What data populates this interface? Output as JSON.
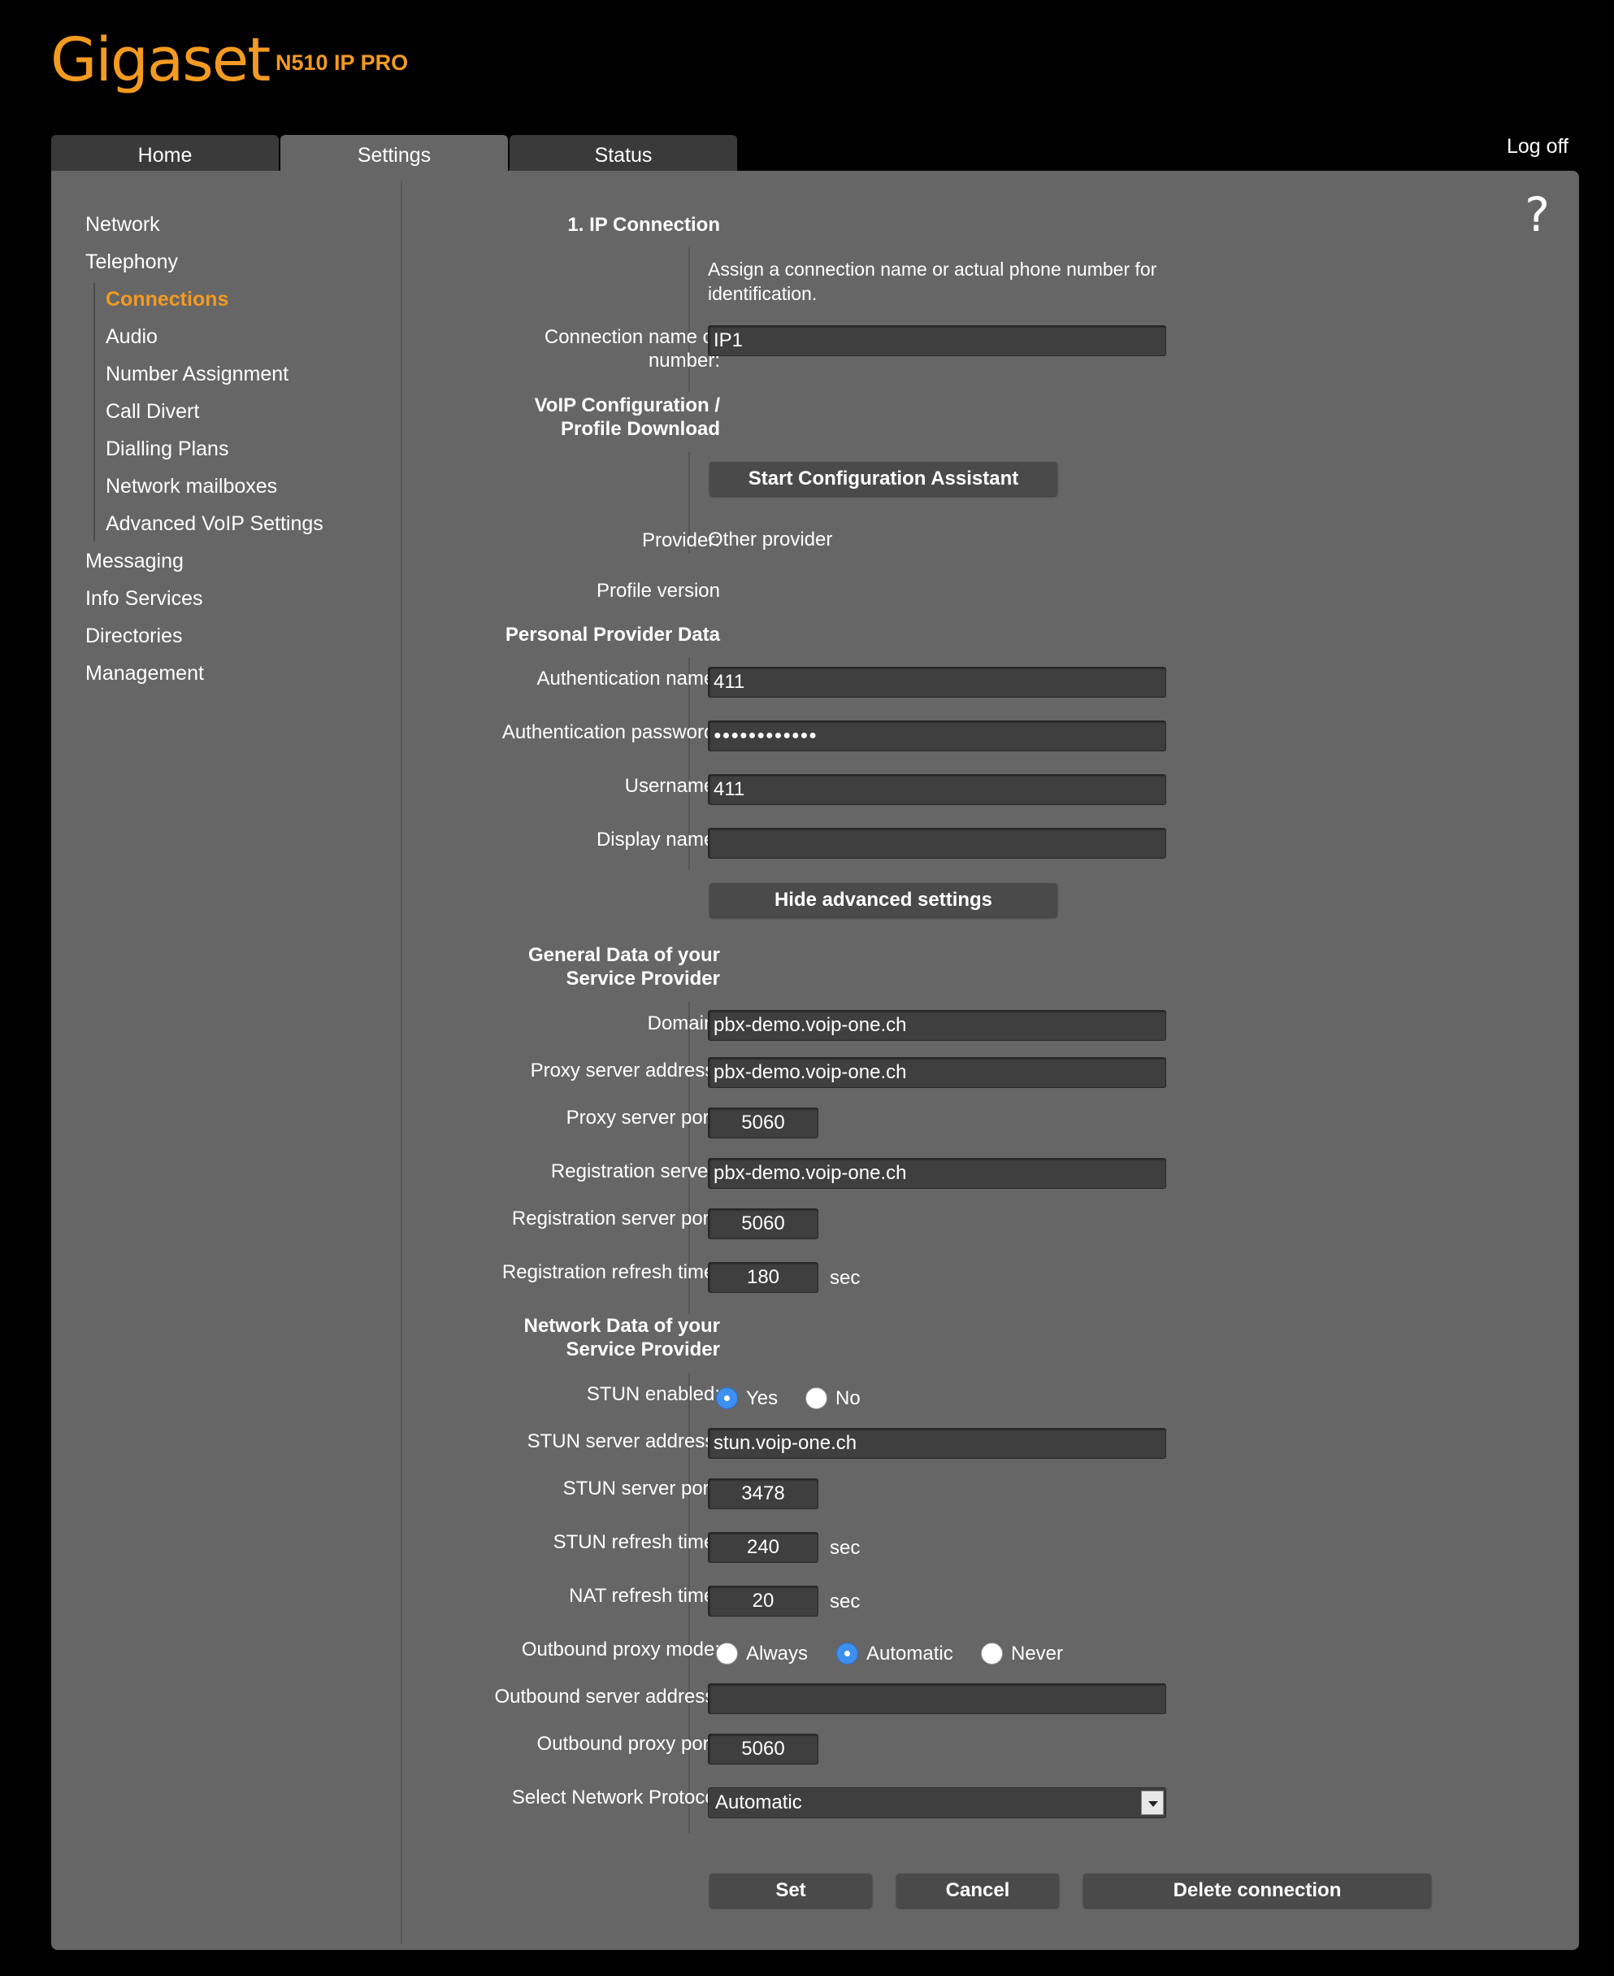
{
  "brand": {
    "logo": "Gigaset",
    "model": "N510 IP PRO"
  },
  "tabs": [
    {
      "label": "Home"
    },
    {
      "label": "Settings"
    },
    {
      "label": "Status"
    }
  ],
  "logoff_label": "Log off",
  "help_icon": "?",
  "sidebar": {
    "items": [
      {
        "label": "Network"
      },
      {
        "label": "Telephony"
      },
      {
        "label": "Connections"
      },
      {
        "label": "Audio"
      },
      {
        "label": "Number Assignment"
      },
      {
        "label": "Call Divert"
      },
      {
        "label": "Dialling Plans"
      },
      {
        "label": "Network mailboxes"
      },
      {
        "label": "Advanced VoIP Settings"
      },
      {
        "label": "Messaging"
      },
      {
        "label": "Info Services"
      },
      {
        "label": "Directories"
      },
      {
        "label": "Management"
      }
    ]
  },
  "form": {
    "ip_connection": {
      "heading": "1. IP Connection",
      "description": "Assign a connection name or actual phone number for identification.",
      "connection_name_label_1": "Connection name or",
      "connection_name_label_2": "number:",
      "connection_name_value": "IP1"
    },
    "voip_config": {
      "heading_1": "VoIP Configuration /",
      "heading_2": "Profile Download",
      "assistant_button": "Start Configuration Assistant",
      "provider_label": "Provider:",
      "provider_value": "Other provider",
      "profile_version_label": "Profile version"
    },
    "personal": {
      "heading": "Personal Provider Data",
      "auth_name_label": "Authentication name:",
      "auth_name_value": "411",
      "auth_password_label": "Authentication password:",
      "auth_password_value": "●●●●●●●●●●●●",
      "username_label": "Username:",
      "username_value": "411",
      "display_name_label": "Display name:",
      "display_name_value": "",
      "advanced_button": "Hide advanced settings"
    },
    "general": {
      "heading_1": "General Data of your",
      "heading_2": "Service Provider",
      "domain_label": "Domain:",
      "domain_value": "pbx-demo.voip-one.ch",
      "proxy_address_label": "Proxy server address:",
      "proxy_address_value": "pbx-demo.voip-one.ch",
      "proxy_port_label": "Proxy server port:",
      "proxy_port_value": "5060",
      "registrar_label": "Registration server:",
      "registrar_value": "pbx-demo.voip-one.ch",
      "registrar_port_label": "Registration server port:",
      "registrar_port_value": "5060",
      "refresh_label": "Registration refresh time:",
      "refresh_value": "180",
      "unit_sec": "sec"
    },
    "network": {
      "heading_1": "Network Data of your",
      "heading_2": "Service Provider",
      "stun_enabled_label": "STUN enabled:",
      "stun_yes": "Yes",
      "stun_no": "No",
      "stun_enabled_selected": "Yes",
      "stun_address_label": "STUN server address:",
      "stun_address_value": "stun.voip-one.ch",
      "stun_port_label": "STUN server port:",
      "stun_port_value": "3478",
      "stun_refresh_label": "STUN refresh time:",
      "stun_refresh_value": "240",
      "nat_refresh_label": "NAT refresh time:",
      "nat_refresh_value": "20",
      "outbound_mode_label": "Outbound proxy mode:",
      "outbound_always": "Always",
      "outbound_automatic": "Automatic",
      "outbound_never": "Never",
      "outbound_mode_selected": "Automatic",
      "outbound_address_label": "Outbound server address:",
      "outbound_address_value": "",
      "outbound_port_label": "Outbound proxy port:",
      "outbound_port_value": "5060",
      "protocol_label": "Select Network Protocol",
      "protocol_value": "Automatic"
    },
    "actions": {
      "set": "Set",
      "cancel": "Cancel",
      "delete": "Delete connection"
    }
  },
  "colors": {
    "accent": "#f39a21",
    "panel_bg": "#666666",
    "tab_bg": "#3a3a3a",
    "radio_selected": "#3d8ff0"
  }
}
